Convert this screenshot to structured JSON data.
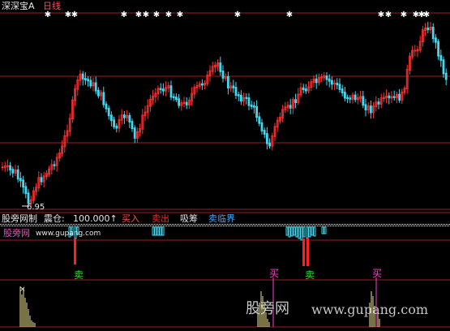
{
  "header": {
    "title": "深深宝A",
    "period": "日线"
  },
  "main_chart": {
    "low_price_label": "6.95"
  },
  "indicator": {
    "name": "股旁网制",
    "position_label": "震仓:",
    "position_value": "100.000↑",
    "buy_label": "买入",
    "sell_label": "卖出",
    "accumulate_label": "吸筹",
    "sell_zone_label": "卖临界"
  },
  "signals": {
    "sell": "卖",
    "buy": "买",
    "sell_strong": "卖"
  },
  "watermark": {
    "site_cn": "股旁网",
    "site_url": "www.gupang.com",
    "brand_cn": "股旁网",
    "brand_url": "www.gupang.com"
  },
  "colors": {
    "up": "#ff3030",
    "down": "#44d8f0",
    "grid": "#9a1e1e",
    "buy": "#ff3fd0",
    "sell": "#3ad03a",
    "volume": "#f0e68c"
  },
  "chart_data": {
    "type": "candlestick",
    "title": "深深宝A 日线",
    "annotations": [
      "6.95"
    ],
    "series": [
      {
        "name": "买入",
        "kind": "signal"
      },
      {
        "name": "卖出",
        "kind": "signal"
      },
      {
        "name": "吸筹",
        "kind": "signal"
      },
      {
        "name": "卖临界",
        "kind": "signal"
      }
    ]
  }
}
